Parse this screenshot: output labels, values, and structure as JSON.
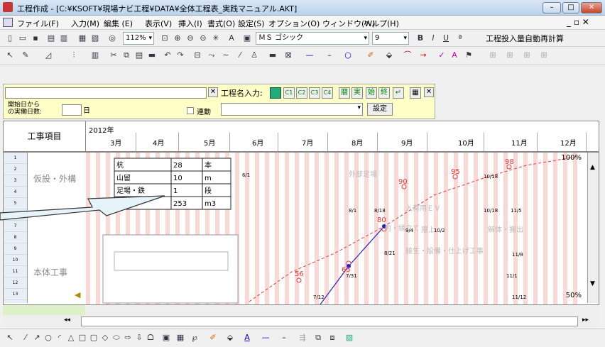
{
  "window": {
    "title": "工程作成 - [C:¥KSOFT¥現場ナビ工程¥DATA¥全体工程表_実践マニュアル.AKT]",
    "min_label": "–",
    "max_label": "□",
    "close_label": "✕"
  },
  "menu": [
    "ファイル(F)",
    "入力(M)",
    "編集 (E)",
    "表示(V)",
    "挿入(I)",
    "書式(O)",
    "設定(S)",
    "オプション(O)",
    "ウィンドウ(W)",
    "ヘルプ(H)"
  ],
  "toolbar1": {
    "zoom": "112%",
    "font": "ＭＳ ゴシック",
    "size": "9",
    "bold": "B",
    "italic": "I",
    "underline": "U",
    "auto_calc": "工程投入量自動再計算"
  },
  "panel": {
    "name_input_label": "工程名入力:",
    "buttons": [
      "C1",
      "C2",
      "C3",
      "C4",
      "暦",
      "実",
      "始",
      "終"
    ],
    "start_label": "開始日から\nの実働日数:",
    "day_suffix": "日",
    "link_label": "連動",
    "set_button": "設定"
  },
  "header": {
    "item_col": "工事項目",
    "year": "2012年",
    "months": [
      "3月",
      "4月",
      "5月",
      "6月",
      "7月",
      "8月",
      "9月",
      "10月",
      "11月",
      "12月"
    ]
  },
  "rows": {
    "numbers": [
      "1",
      "2",
      "3",
      "4",
      "5",
      "6",
      "7",
      "8",
      "9",
      "10",
      "11",
      "12",
      "13"
    ],
    "items": [
      "仮設・外構",
      "本体工事"
    ]
  },
  "table": [
    [
      "杭",
      "28",
      "本"
    ],
    [
      "山留",
      "10",
      "m"
    ],
    [
      "足場・鉄",
      "1",
      "段"
    ],
    [
      "",
      "253",
      "m3"
    ]
  ],
  "chart_data": {
    "type": "line",
    "title": "",
    "percent_top": "100%",
    "percent_mid": "50%",
    "s_curve": [
      {
        "label": "56",
        "x": "5月下旬"
      },
      {
        "label": "65",
        "x": "7月"
      },
      {
        "label": "80",
        "x": "8月"
      },
      {
        "label": "90",
        "x": "8月"
      },
      {
        "label": "95",
        "x": "9月"
      },
      {
        "label": "98",
        "x": "11月"
      }
    ],
    "tasks": [
      "外部足場",
      "入荷用ＥＶ",
      "解体・搬出",
      "屋上",
      "内・縁立て",
      "雑生・設備・仕上げ工事"
    ],
    "dates": [
      "6/1",
      "8/1",
      "8/18",
      "9/4",
      "10/2",
      "10/18",
      "11/5",
      "8/21",
      "11/8",
      "11/1",
      "11/12",
      "10/18",
      "7/12",
      "7/31"
    ]
  },
  "bottom": {
    "nav_left": "◂◂",
    "nav_right": "▸▸"
  }
}
